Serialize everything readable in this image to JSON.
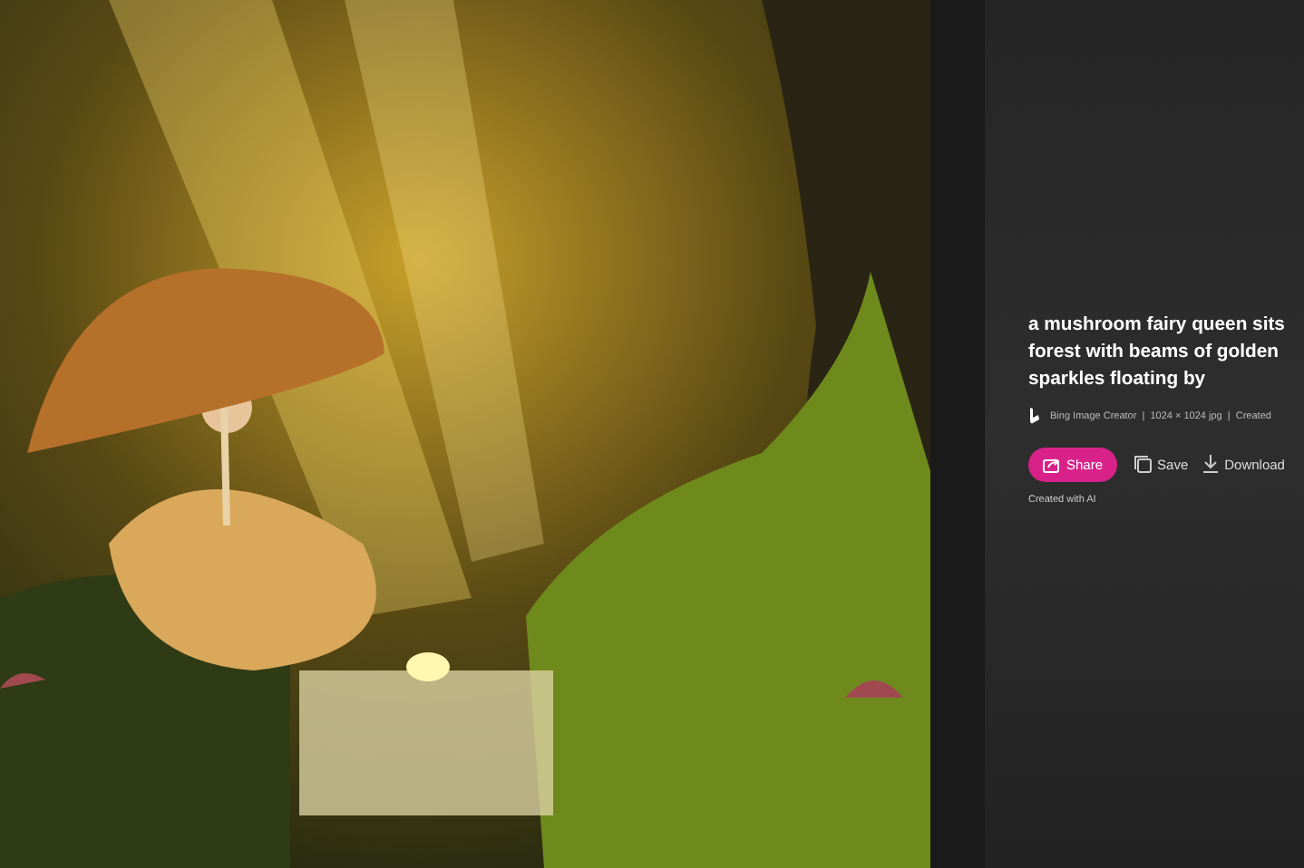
{
  "details": {
    "title_lines": [
      "a mushroom fairy queen sits",
      "forest with beams of golden",
      "sparkles floating by"
    ],
    "meta": "Bing Image Creator  |  1024 × 1024 jpg  |  Created",
    "actions": [
      {
        "kind": "share",
        "label": "Share"
      },
      {
        "kind": "save",
        "label": "Save"
      },
      {
        "kind": "download",
        "label": "Download"
      }
    ],
    "note": "Created with AI"
  }
}
